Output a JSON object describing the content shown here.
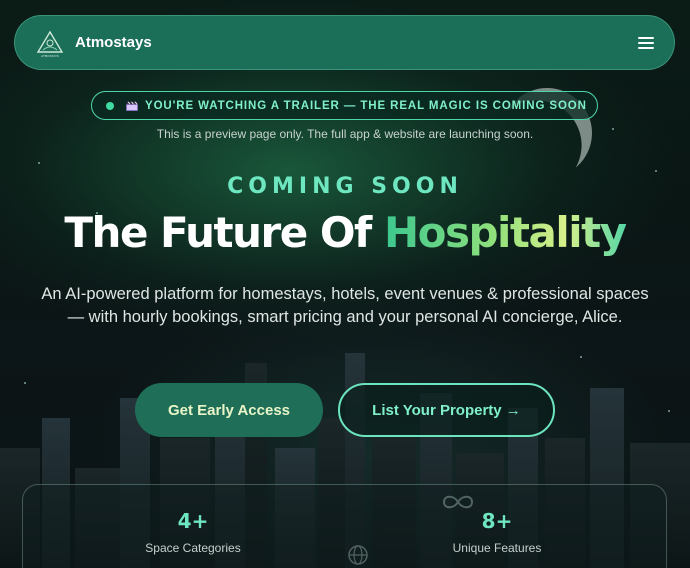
{
  "nav": {
    "brand": "Atmostays",
    "logo_icon": "atmostays-logo-icon",
    "logo_caption": "ATMOSTAYS",
    "menu_icon": "hamburger-menu-icon"
  },
  "banner": {
    "icon": "clapperboard-icon",
    "text": "YOU'RE WATCHING A TRAILER — THE REAL MAGIC IS COMING SOON"
  },
  "preview_note": "This is a preview page only. The full app & website are launching soon.",
  "hero": {
    "eyebrow": "COMING SOON",
    "headline_main": "The Future Of ",
    "headline_accent": "Hospitality",
    "subtitle": "An AI-powered platform for homestays, hotels, event venues & professional spaces — with hourly bookings, smart pricing and your personal AI concierge, Alice."
  },
  "buttons": {
    "primary": "Get Early Access",
    "secondary": "List Your Property →"
  },
  "stats": [
    {
      "value": "4+",
      "label": "Space Categories"
    },
    {
      "value": "8+",
      "label": "Unique Features"
    }
  ],
  "colors": {
    "nav_bg": "#1b6e58",
    "accent": "#6ee6c0",
    "banner_text": "#7ff0c8",
    "primary_button_bg": "#1f6f58",
    "primary_button_text": "#e9f4c8"
  }
}
